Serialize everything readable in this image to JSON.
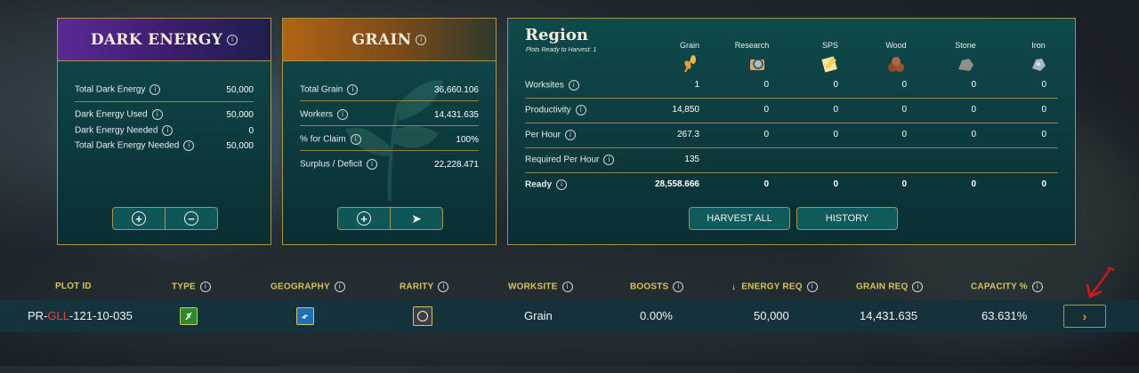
{
  "dark_energy": {
    "title": "DARK ENERGY",
    "rows": [
      {
        "label": "Total Dark Energy",
        "value": "50,000"
      },
      {
        "label": "Dark Energy Used",
        "value": "50,000"
      },
      {
        "label": "Dark Energy Needed",
        "value": "0"
      },
      {
        "label": "Total Dark Energy Needed",
        "value": "50,000"
      }
    ],
    "buttons": {
      "add": "+",
      "remove": "−"
    }
  },
  "grain": {
    "title": "GRAIN",
    "rows": [
      {
        "label": "Total Grain",
        "value": "36,660.106"
      },
      {
        "label": "Workers",
        "value": "14,431.635"
      },
      {
        "label": "% for Claim",
        "value": "100%"
      },
      {
        "label": "Surplus / Deficit",
        "value": "22,228.471"
      }
    ],
    "buttons": {
      "add": "+",
      "send": "➤"
    }
  },
  "region": {
    "title": "Region",
    "subtitle": "Plots Ready to Harvest: 1",
    "columns": [
      "Grain",
      "Research",
      "SPS",
      "Wood",
      "Stone",
      "Iron"
    ],
    "rows": [
      {
        "label": "Worksites",
        "values": [
          "1",
          "0",
          "0",
          "0",
          "0",
          "0"
        ]
      },
      {
        "label": "Productivity",
        "values": [
          "14,850",
          "0",
          "0",
          "0",
          "0",
          "0"
        ]
      },
      {
        "label": "Per Hour",
        "values": [
          "267.3",
          "0",
          "0",
          "0",
          "0",
          "0"
        ]
      },
      {
        "label": "Required Per Hour",
        "values": [
          "135",
          "",
          "",
          "",
          "",
          ""
        ]
      },
      {
        "label": "Ready",
        "values": [
          "28,558.666",
          "0",
          "0",
          "0",
          "0",
          "0"
        ]
      }
    ],
    "harvest_all": "HARVEST ALL",
    "history": "HISTORY"
  },
  "table": {
    "headers": [
      "PLOT ID",
      "TYPE",
      "GEOGRAPHY",
      "RARITY",
      "WORKSITE",
      "BOOSTS",
      "ENERGY REQ",
      "GRAIN REQ",
      "CAPACITY %"
    ],
    "sort_arrow": "↓",
    "row": {
      "plot_id_prefix": "PR-",
      "plot_id_region": "GLL",
      "plot_id_suffix": "-121-10-035",
      "worksite": "Grain",
      "boosts": "0.00%",
      "energy_req": "50,000",
      "grain_req": "14,431.635",
      "capacity": "63.631%"
    }
  },
  "colors": {
    "accent_gold": "#b0913e",
    "header_gold": "#d8c25a",
    "plot_region_red": "#e0453a",
    "arrow_red": "#d81818"
  }
}
